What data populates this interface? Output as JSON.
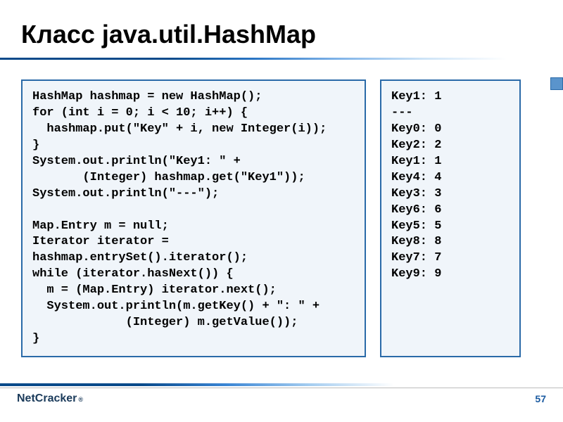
{
  "title": "Класс java.util.HashMap",
  "code_left": "HashMap hashmap = new HashMap();\nfor (int i = 0; i < 10; i++) {\n  hashmap.put(\"Key\" + i, new Integer(i));\n}\nSystem.out.println(\"Key1: \" +\n       (Integer) hashmap.get(\"Key1\"));\nSystem.out.println(\"---\");\n\nMap.Entry m = null;\nIterator iterator =\nhashmap.entrySet().iterator();\nwhile (iterator.hasNext()) {\n  m = (Map.Entry) iterator.next();\n  System.out.println(m.getKey() + \": \" +\n             (Integer) m.getValue());\n}",
  "code_right": "Key1: 1\n---\nKey0: 0\nKey2: 2\nKey1: 1\nKey4: 4\nKey3: 3\nKey6: 6\nKey5: 5\nKey8: 8\nKey7: 7\nKey9: 9",
  "logo": {
    "part1": "Net",
    "part2": "Cracker",
    "trademark": "®"
  },
  "page_number": "57"
}
